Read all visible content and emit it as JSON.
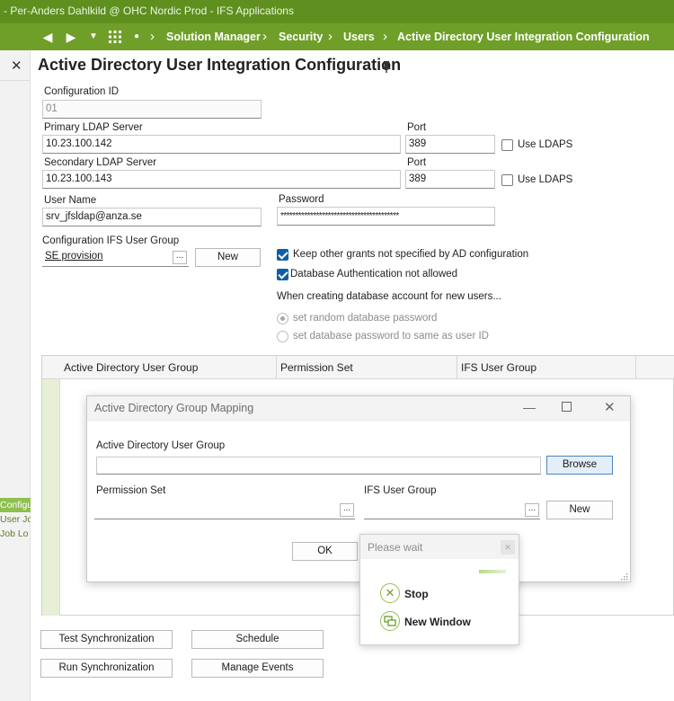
{
  "window": {
    "title": "- Per-Anders Dahlkild @ OHC Nordic Prod - IFS Applications"
  },
  "nav": {
    "breadcrumbs": [
      "Solution Manager",
      "Security",
      "Users",
      "Active Directory User Integration Configuration"
    ]
  },
  "left_panel": {
    "items": [
      "Configu",
      "User Jo",
      "Job Lo"
    ]
  },
  "page": {
    "title": "Active Directory User Integration Configuration"
  },
  "form": {
    "configuration_id": {
      "label": "Configuration ID",
      "value": "01"
    },
    "primary_ldap": {
      "label": "Primary LDAP Server",
      "value": "10.23.100.142"
    },
    "primary_port": {
      "label": "Port",
      "value": "389"
    },
    "primary_use_ldaps": {
      "label": "Use LDAPS",
      "checked": false
    },
    "secondary_ldap": {
      "label": "Secondary LDAP Server",
      "value": "10.23.100.143"
    },
    "secondary_port": {
      "label": "Port",
      "value": "389"
    },
    "secondary_use_ldaps": {
      "label": "Use LDAPS",
      "checked": false
    },
    "user_name": {
      "label": "User Name",
      "value": "srv_jfsldap@anza.se"
    },
    "password": {
      "label": "Password",
      "value": "****************************************"
    },
    "config_ifs_user_group": {
      "label": "Configuration IFS User Group",
      "value": "SE provision",
      "lov": "...",
      "new_label": "New"
    },
    "keep_other_grants": {
      "label": "Keep other grants not specified by AD configuration",
      "checked": true
    },
    "db_auth_not_allowed": {
      "label": "Database Authentication not allowed",
      "checked": true
    },
    "db_account_heading": "When creating database account for new users...",
    "radio_random": {
      "label": "set random database password",
      "selected": true
    },
    "radio_same": {
      "label": "set database password to same as user ID",
      "selected": false
    }
  },
  "grid": {
    "columns": [
      "Active Directory User Group",
      "Permission Set",
      "IFS User Group"
    ]
  },
  "dialog": {
    "title": "Active Directory Group Mapping",
    "ad_user_group": {
      "label": "Active Directory User Group",
      "value": ""
    },
    "browse_label": "Browse",
    "permission_set": {
      "label": "Permission Set",
      "value": "",
      "lov": "..."
    },
    "ifs_user_group": {
      "label": "IFS User Group",
      "value": "",
      "lov": "..."
    },
    "new_label": "New",
    "ok_label": "OK"
  },
  "please_wait": {
    "title": "Please wait",
    "stop_label": "Stop",
    "new_window_label": "New Window"
  },
  "actions": {
    "test_sync": "Test Synchronization",
    "schedule": "Schedule",
    "run_sync": "Run Synchronization",
    "manage_events": "Manage Events"
  },
  "colors": {
    "titlebar": "#5e8f1f",
    "navbar": "#6f9f29",
    "accent_green": "#8fbf4e",
    "checkbox_blue": "#0f5fa8"
  }
}
